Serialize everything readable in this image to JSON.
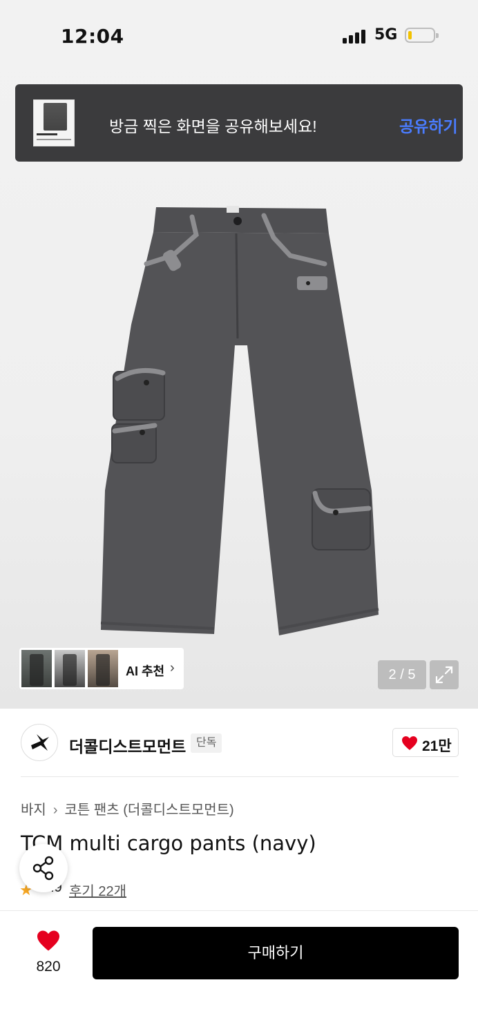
{
  "status_bar": {
    "time": "12:04",
    "network": "5G",
    "battery_level": 0.15
  },
  "toast": {
    "message": "방금 찍은 화면을 공유해보세요!",
    "action_label": "공유하기"
  },
  "gallery": {
    "ai_label": "AI 추천",
    "pager": "2 / 5",
    "current_page": 2,
    "total_pages": 5
  },
  "brand": {
    "name": "더콜디스트모먼트",
    "badge": "단독",
    "likes": "21만"
  },
  "breadcrumb": {
    "category": "바지",
    "subcategory": "코튼 팬츠 (더콜디스트모먼트)"
  },
  "product": {
    "title": "TCM multi cargo pants (navy)",
    "rating": "4.9",
    "reviews": "후기 22개"
  },
  "bottom": {
    "wish_count": "820",
    "buy_label": "구매하기"
  },
  "colors": {
    "accent_link": "#4a7cff",
    "heart": "#e5001f",
    "star": "#f5a623",
    "buy_button": "#000000"
  }
}
